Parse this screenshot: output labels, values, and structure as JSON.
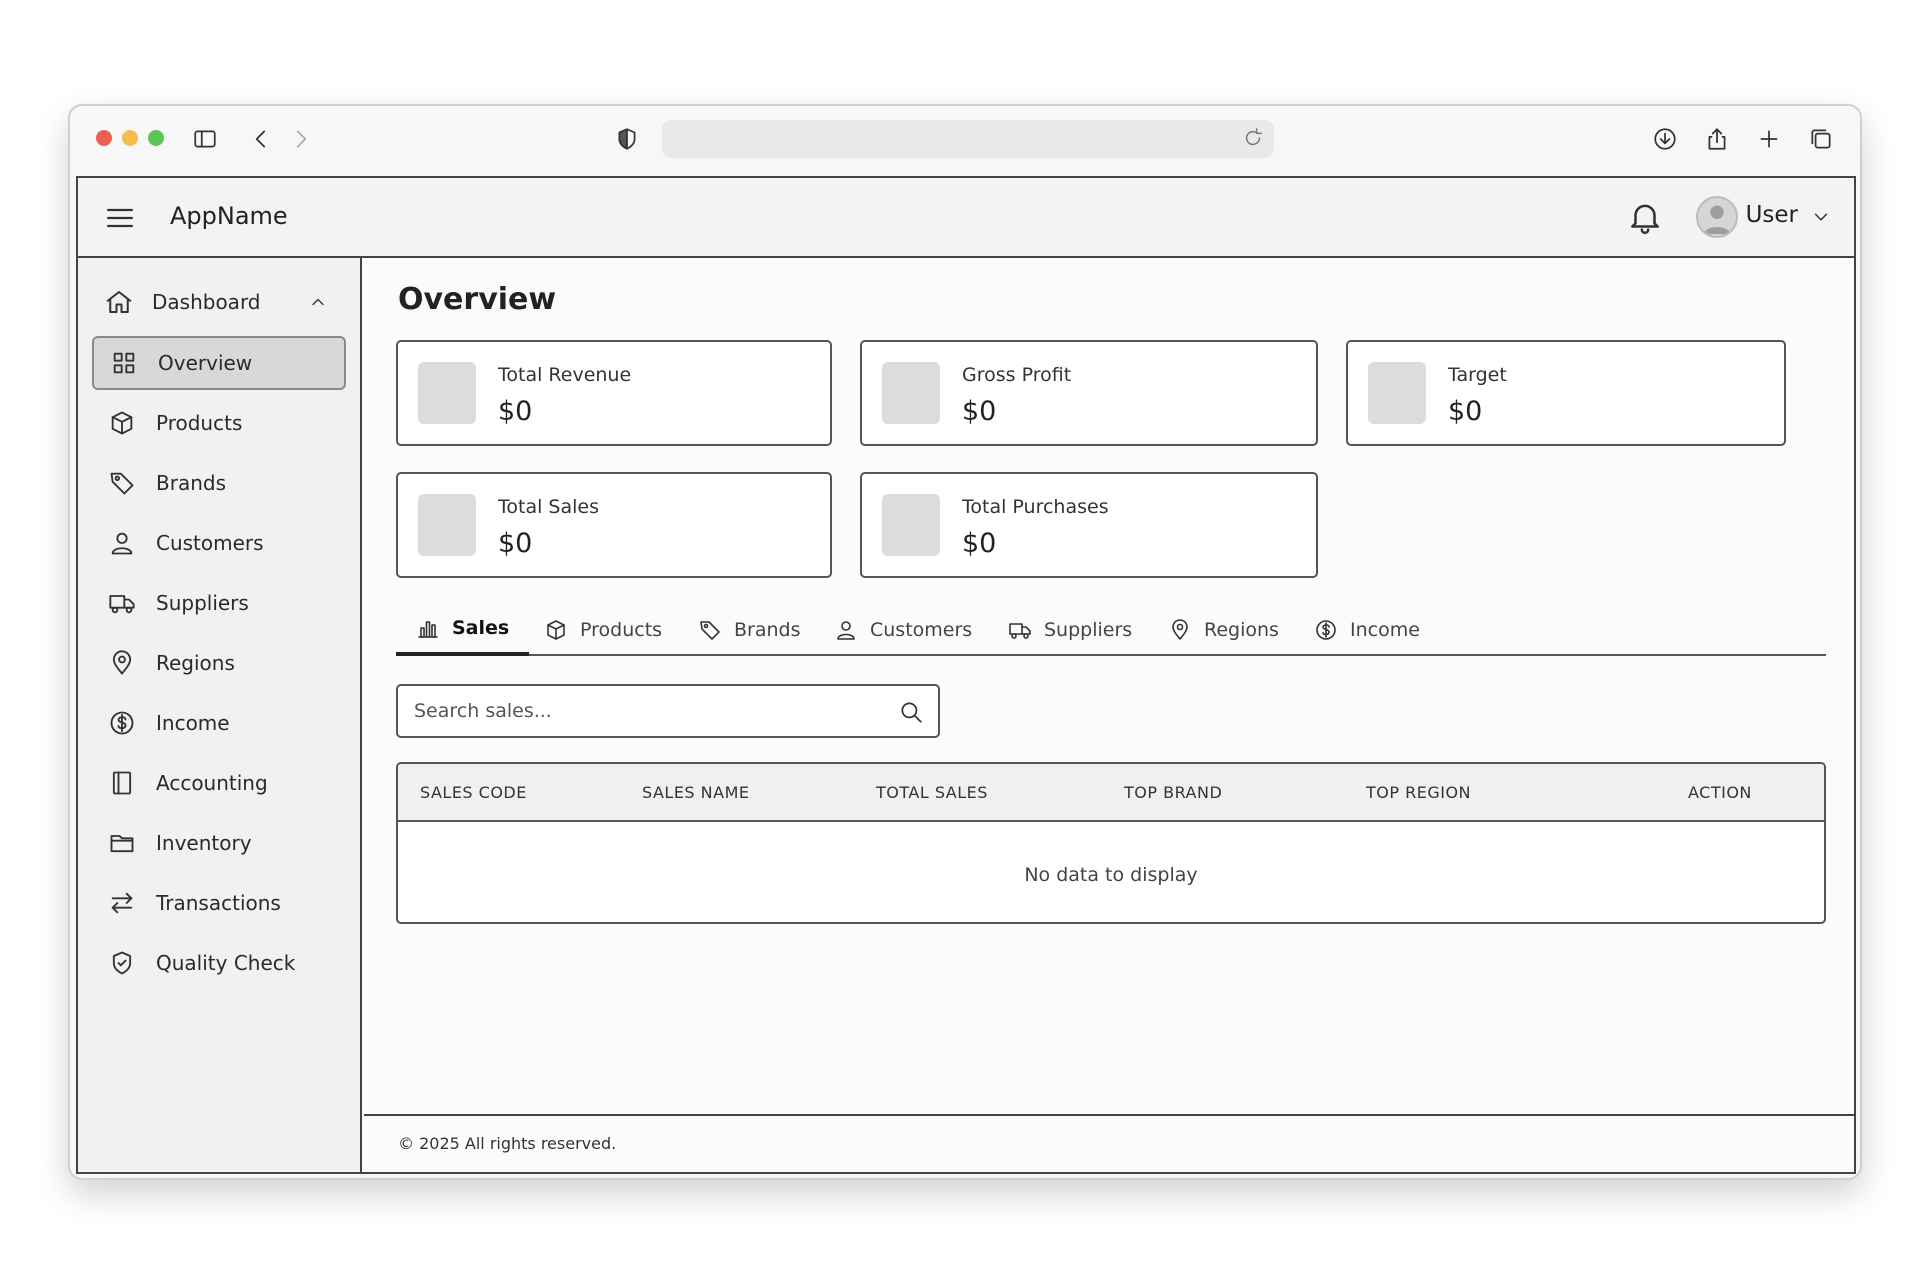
{
  "browser": {
    "url": "",
    "icons": [
      "sidebar-icon",
      "back-icon",
      "forward-icon",
      "shield-icon",
      "reload-icon",
      "download-icon",
      "share-icon",
      "plus-icon",
      "tabs-icon"
    ]
  },
  "header": {
    "app_name": "AppName",
    "user_name": "User"
  },
  "sidebar": {
    "group_label": "Dashboard",
    "items": [
      {
        "label": "Overview",
        "icon": "grid-icon",
        "active": true
      },
      {
        "label": "Products",
        "icon": "box-icon"
      },
      {
        "label": "Brands",
        "icon": "tag-icon"
      },
      {
        "label": "Customers",
        "icon": "user-icon"
      },
      {
        "label": "Suppliers",
        "icon": "truck-icon"
      },
      {
        "label": "Regions",
        "icon": "map-pin-icon"
      },
      {
        "label": "Income",
        "icon": "dollar-icon"
      },
      {
        "label": "Accounting",
        "icon": "ledger-icon"
      },
      {
        "label": "Inventory",
        "icon": "folder-icon"
      },
      {
        "label": "Transactions",
        "icon": "swap-icon"
      },
      {
        "label": "Quality Check",
        "icon": "shield-check-icon"
      }
    ]
  },
  "main": {
    "title": "Overview",
    "cards": [
      {
        "label": "Total Revenue",
        "value": "$0"
      },
      {
        "label": "Gross Profit",
        "value": "$0"
      },
      {
        "label": "Target",
        "value": "$0"
      },
      {
        "label": "Total Sales",
        "value": "$0"
      },
      {
        "label": "Total Purchases",
        "value": "$0"
      }
    ],
    "tabs": [
      {
        "label": "Sales",
        "icon": "bar-chart-icon",
        "active": true
      },
      {
        "label": "Products",
        "icon": "box-icon"
      },
      {
        "label": "Brands",
        "icon": "tag-icon"
      },
      {
        "label": "Customers",
        "icon": "user-icon"
      },
      {
        "label": "Suppliers",
        "icon": "truck-icon"
      },
      {
        "label": "Regions",
        "icon": "map-pin-icon"
      },
      {
        "label": "Income",
        "icon": "dollar-icon"
      }
    ],
    "search": {
      "placeholder": "Search sales...",
      "value": ""
    },
    "table": {
      "columns": [
        "SALES CODE",
        "SALES NAME",
        "TOTAL SALES",
        "TOP BRAND",
        "TOP REGION",
        "ACTION"
      ],
      "rows": [],
      "empty_text": "No data to display"
    }
  },
  "footer": {
    "text": "© 2025 All rights reserved."
  }
}
